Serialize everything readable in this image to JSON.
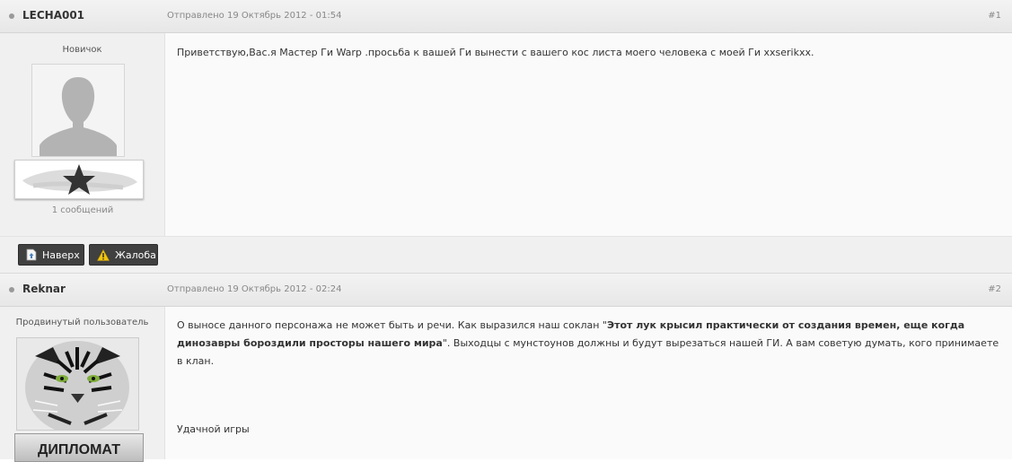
{
  "posts": [
    {
      "author": "LECHA001",
      "posted": "Отправлено 19 Октябрь 2012 - 01:54",
      "number": "#1",
      "rank": "Новичок",
      "post_count": "1 сообщений",
      "avatar_icon": "default-user-silhouette-icon",
      "rank_icon": "star-icon",
      "text": "Приветствую,Вас.я Мастер Ги Warp .просьба к вашей Ги вынести с вашего кос листа моего человека с моей Ги  xxserikxx.",
      "footer": {
        "top_label": "Наверх",
        "report_label": "Жалоба"
      }
    },
    {
      "author": "Reknar",
      "posted": "Отправлено 19 Октябрь 2012 - 02:24",
      "number": "#2",
      "rank": "Продвинутый пользователь",
      "avatar_icon": "tiger-avatar-icon",
      "badge_text": "ДИПЛОМАТ",
      "text_intro": "О выносе данного персонажа не может быть и речи. Как выразился наш соклан \"",
      "text_bold": "Этот лук крысил практически от создания времен, еще когда динозавры бороздили просторы нашего мира",
      "text_rest": "\".  Выходцы с мунстоунов должны и будут вырезаться нашей ГИ. А вам советую думать, кого принимаете в клан.",
      "text_closing": "Удачной игры"
    }
  ],
  "colors": {
    "header_bg": "#ebebeb",
    "button_bg": "#404040",
    "warning": "#f1c40f"
  }
}
